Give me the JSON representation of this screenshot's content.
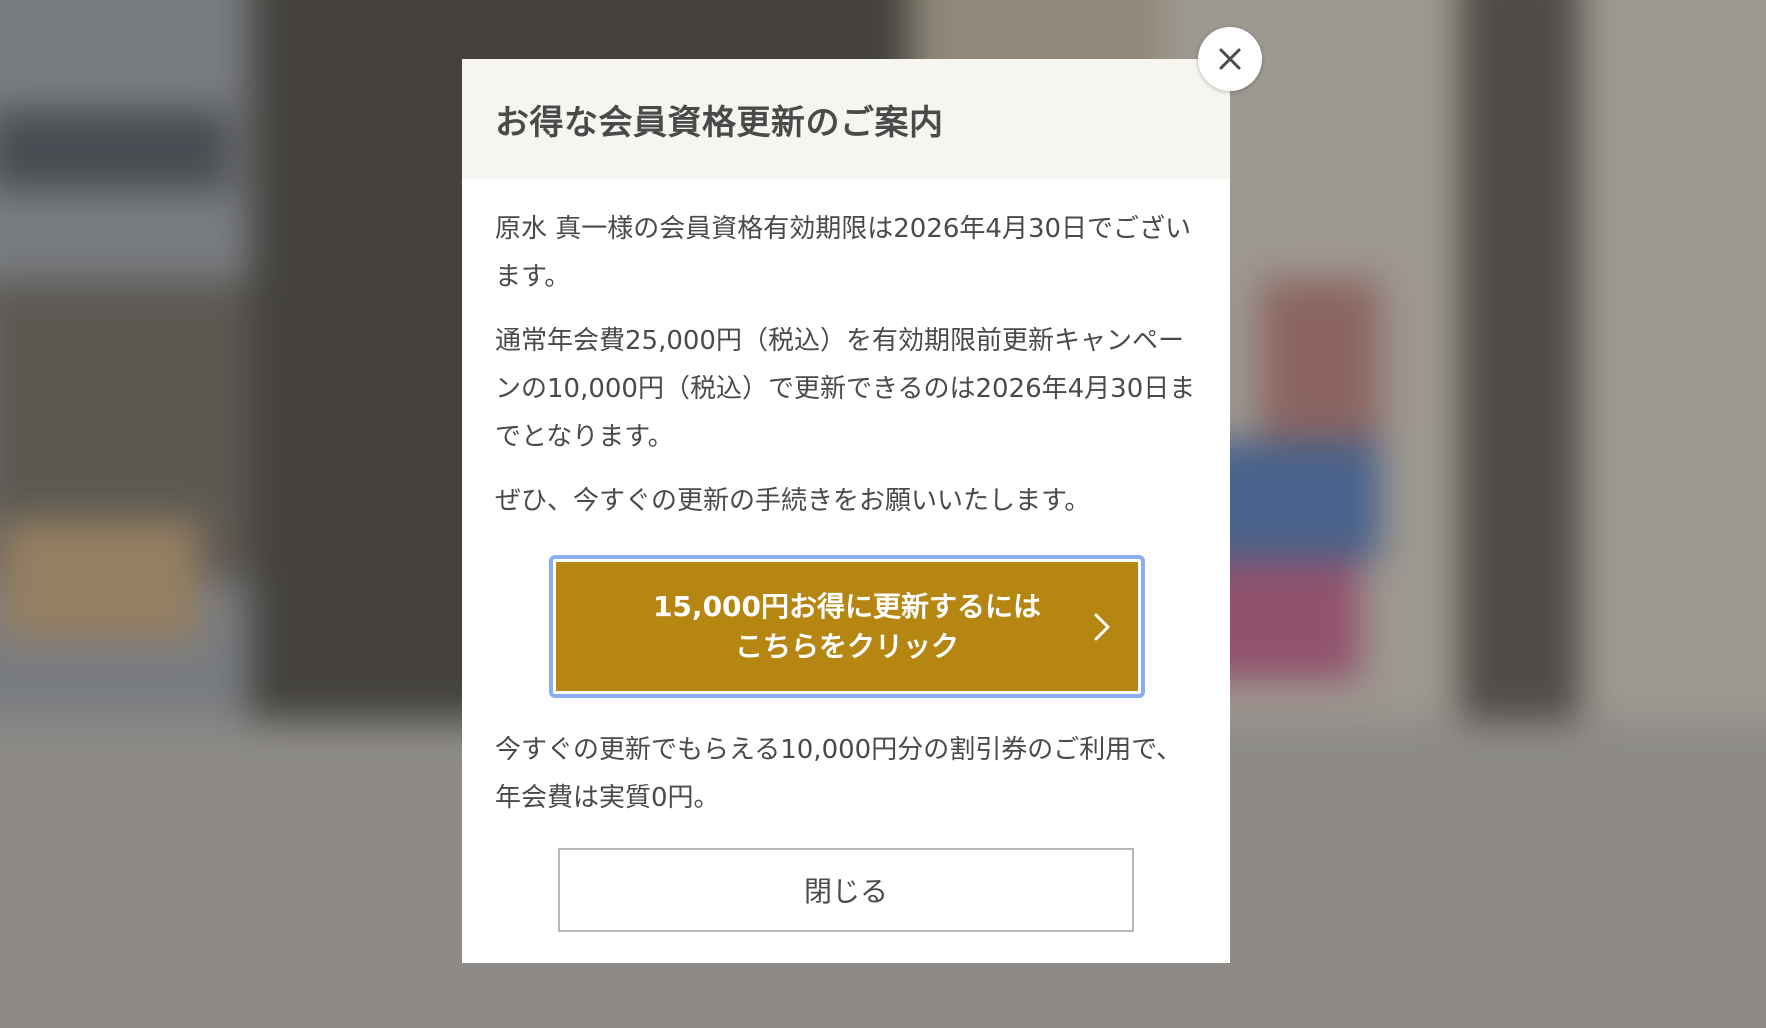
{
  "modal": {
    "title": "お得な会員資格更新のご案内",
    "paragraph_1": "原水 真一様の会員資格有効期限は2026年4月30日でございます。",
    "paragraph_2": "通常年会費25,000円（税込）を有効期限前更新キャンペーンの10,000円（税込）で更新できるのは2026年4月30日までとなります。",
    "paragraph_3": "ぜひ、今すぐの更新の手続きをお願いいたします。",
    "cta": {
      "line_1": "15,000円お得に更新するには",
      "line_2": "こちらをクリック",
      "icon": "chevron-right-icon",
      "color": "#b58612",
      "focus_ring_color": "#8aaef0"
    },
    "paragraph_4": "今すぐの更新でもらえる10,000円分の割引券のご利用で、年会費は実質0円。",
    "close_button_label": "閉じる",
    "close_icon": "close-icon"
  }
}
